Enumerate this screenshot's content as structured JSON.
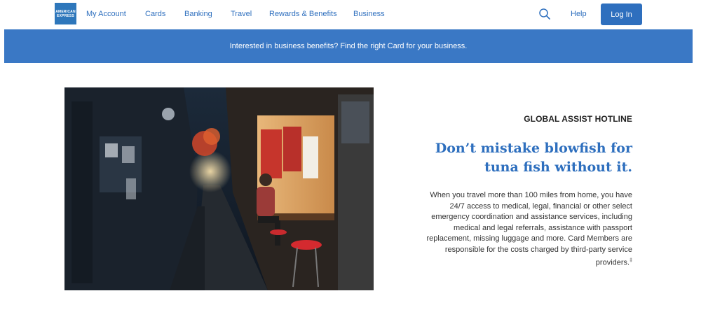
{
  "brand": {
    "logo_line1": "AMERICAN",
    "logo_line2": "EXPRESS",
    "color": "#2e77bb"
  },
  "nav": {
    "items": [
      "My Account",
      "Cards",
      "Banking",
      "Travel",
      "Rewards & Benefits",
      "Business"
    ],
    "search_icon": "search-icon",
    "help_label": "Help",
    "login_label": "Log In"
  },
  "banner": {
    "text": "Interested in business benefits? Find the right Card for your business.",
    "color": "#3a78c5"
  },
  "feature": {
    "eyebrow": "GLOBAL ASSIST HOTLINE",
    "headline": "Don’t mistake blowfish for tuna fish without it.",
    "body": "When you travel more than 100 miles from home, you have 24/7 access to medical, legal, financial or other select emergency coordination and assistance services, including medical and legal referrals, assistance with passport replacement, missing luggage and more. Card Members are responsible for the costs charged by third-party service providers.",
    "footnote_mark": "‡"
  },
  "colors": {
    "accent": "#2e6fbe",
    "text": "#333333"
  }
}
